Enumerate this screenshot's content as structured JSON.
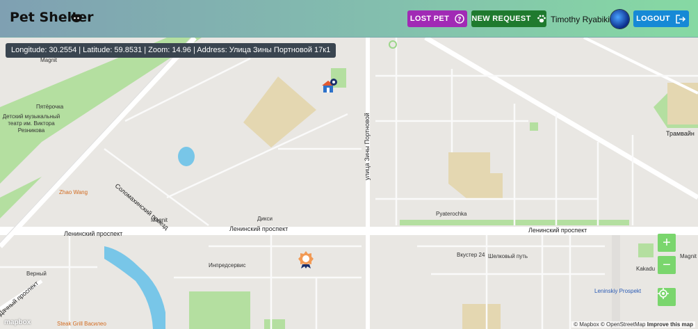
{
  "header": {
    "title": "Pet Shelter",
    "lost_pet_label": "LOST PET",
    "new_request_label": "NEW REQUEST",
    "user_name": "Timothy Ryabikin",
    "logout_label": "LOGOUT"
  },
  "map": {
    "coord_text": "Longitude: 30.2554 | Latitude: 59.8531 | Zoom: 14.96 | Address: Улица Зины Портновой 17к1",
    "attribution": "© Mapbox © OpenStreetMap",
    "improve": "Improve this map",
    "logo": "mapbox",
    "labels": {
      "magnit_1": "Magnit",
      "pyaterochka_1": "Пятёрочка",
      "theatre": "Детский музыкальный\nтеатр им. Виктора\nРезникова",
      "zhao": "Zhao Wang",
      "solomakha": "Соломахинский проезд",
      "magnit_2": "Magnit",
      "dixi": "Дикси",
      "zina": "улица Зины Портновой",
      "pyaterochka_2": "Pyaterochka",
      "lenin_1": "Ленинский проспект",
      "lenin_2": "Ленинский проспект",
      "lenin_3": "Ленинский проспект",
      "tramvai": "Трамвайн",
      "inpred": "Инпредсервис",
      "verny": "Верный",
      "vkuster": "Вкустер 24",
      "shelk": "Шелковый путь",
      "kakadu": "Kakadu",
      "magnit_3": "Magnit",
      "leninsky_station": "Leninskiy Prospekt",
      "dachny": "Дачный проспект",
      "steak": "Steak Grill Василео"
    }
  },
  "colors": {
    "lost": "#a12ab5",
    "new": "#1f7a2e",
    "logout": "#1689d6",
    "control": "#7ad66d"
  }
}
